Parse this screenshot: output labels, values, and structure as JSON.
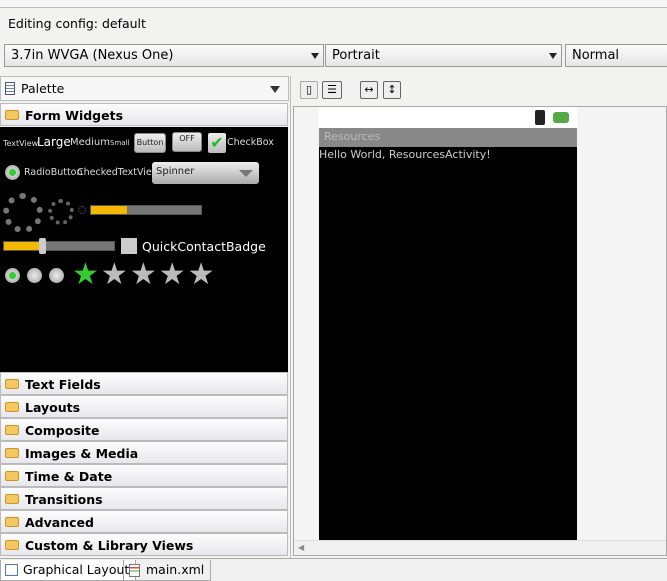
{
  "header": {
    "title": "Editing config: default"
  },
  "config": {
    "device": "3.7in WVGA (Nexus One)",
    "orientation": "Portrait",
    "mode": "Normal"
  },
  "palette": {
    "title": "Palette",
    "open_category": "Form Widgets",
    "categories": [
      "Text Fields",
      "Layouts",
      "Composite",
      "Images & Media",
      "Time & Date",
      "Transitions",
      "Advanced",
      "Custom & Library Views"
    ]
  },
  "widgets": {
    "textview": "TextView",
    "large": "Large",
    "medium": "Medium",
    "small": "Small",
    "button": "Button",
    "toggle": "OFF",
    "checkbox": "CheckBox",
    "radiobutton": "RadioButton",
    "checkedtextview": "CheckedTextView",
    "spinner": "Spinner",
    "progress_fraction": 0.33,
    "seek_fraction": 0.32,
    "quickcontact": "QuickContactBadge",
    "rating": 1,
    "rating_max": 5
  },
  "preview": {
    "app_title": "Resources",
    "hello": "Hello World, ResourcesActivity!"
  },
  "bottom_tabs": [
    "Graphical Layout",
    "main.xml"
  ],
  "colors": {
    "accent_green": "#33cc33",
    "progress": "#f5b800"
  }
}
